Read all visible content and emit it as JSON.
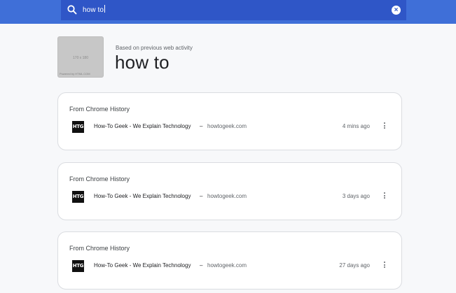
{
  "search": {
    "query": "how to",
    "icon": "search-icon",
    "clear_icon": "close-circle-icon"
  },
  "header": {
    "thumbnail_dims": "170 x 180",
    "thumbnail_credit": "Powered by HTML.COM",
    "activity_label": "Based on previous web activity",
    "title": "how to"
  },
  "results": [
    {
      "header": "From Chrome History",
      "logo_text": "HTG",
      "title": "How-To Geek - We Explain Technology",
      "separator": "–",
      "domain": "howtogeek.com",
      "time": "4 mins ago",
      "menu_icon": "more-vert-icon"
    },
    {
      "header": "From Chrome History",
      "logo_text": "HTG",
      "title": "How-To Geek - We Explain Technology",
      "separator": "–",
      "domain": "howtogeek.com",
      "time": "3 days ago",
      "menu_icon": "more-vert-icon"
    },
    {
      "header": "From Chrome History",
      "logo_text": "HTG",
      "title": "How-To Geek - We Explain Technology",
      "separator": "–",
      "domain": "howtogeek.com",
      "time": "27 days ago",
      "menu_icon": "more-vert-icon"
    }
  ],
  "colors": {
    "topbar": "#3f6fd8",
    "searchbox": "#2f56c7",
    "background": "#f7f8fa",
    "card_border": "#dadce0"
  }
}
